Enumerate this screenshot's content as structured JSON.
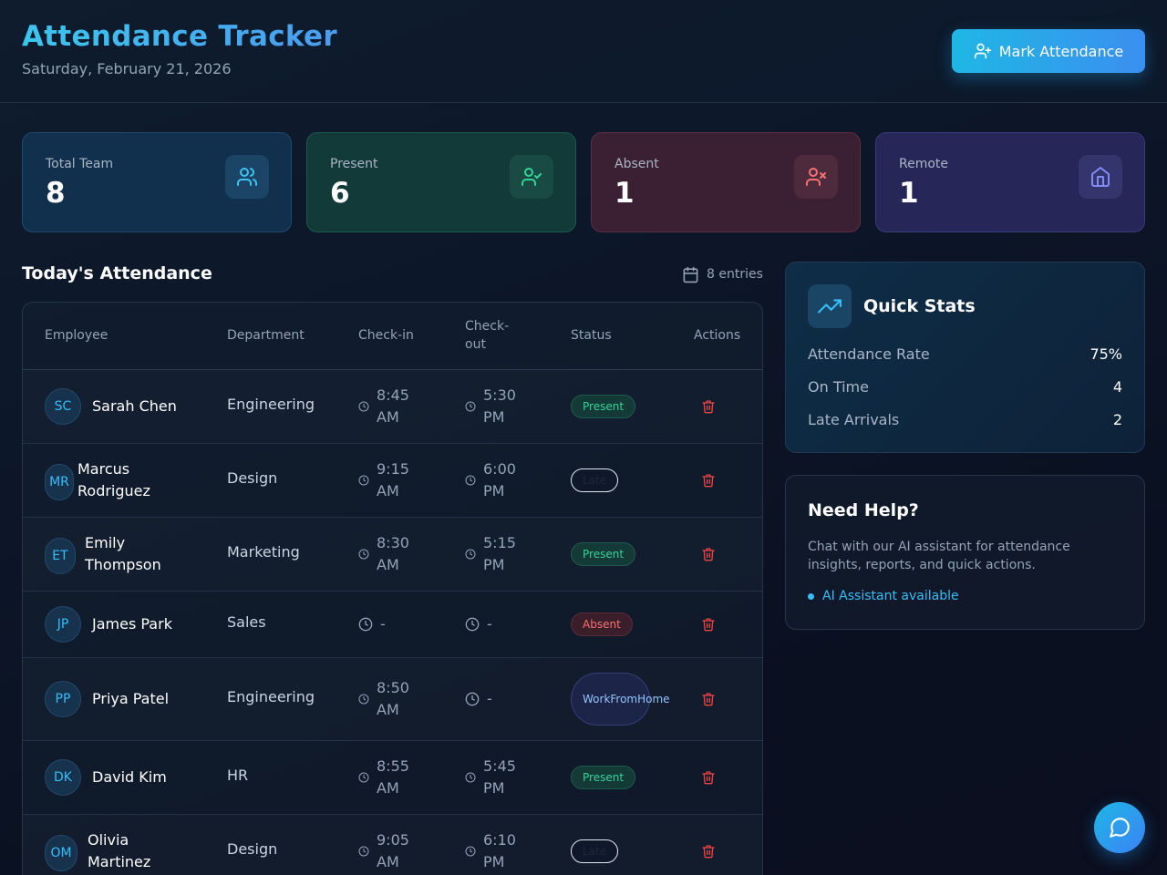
{
  "header": {
    "title": "Attendance Tracker",
    "date": "Saturday, February 21, 2026",
    "mark_button": "Mark Attendance"
  },
  "stats": [
    {
      "label": "Total Team",
      "value": "8",
      "icon": "users-icon"
    },
    {
      "label": "Present",
      "value": "6",
      "icon": "user-check-icon"
    },
    {
      "label": "Absent",
      "value": "1",
      "icon": "user-x-icon"
    },
    {
      "label": "Remote",
      "value": "1",
      "icon": "home-icon"
    }
  ],
  "attendance": {
    "title": "Today's Attendance",
    "entries": "8 entries",
    "columns": {
      "employee": "Employee",
      "department": "Department",
      "checkin": "Check-in",
      "checkout_1": "Check-",
      "checkout_2": "out",
      "status": "Status",
      "actions": "Actions"
    },
    "rows": [
      {
        "initials": "SC",
        "name": "Sarah Chen",
        "department": "Engineering",
        "checkin": [
          "8:45",
          "AM"
        ],
        "checkout": [
          "5:30",
          "PM"
        ],
        "status": "Present"
      },
      {
        "initials": "MR",
        "name": [
          "Marcus",
          "Rodriguez"
        ],
        "department": "Design",
        "checkin": [
          "9:15",
          "AM"
        ],
        "checkout": [
          "6:00",
          "PM"
        ],
        "status": "Late"
      },
      {
        "initials": "ET",
        "name": [
          "Emily",
          "Thompson"
        ],
        "department": "Marketing",
        "checkin": [
          "8:30",
          "AM"
        ],
        "checkout": [
          "5:15",
          "PM"
        ],
        "status": "Present"
      },
      {
        "initials": "JP",
        "name": "James Park",
        "department": "Sales",
        "checkin": "-",
        "checkout": "-",
        "status": "Absent"
      },
      {
        "initials": "PP",
        "name": "Priya Patel",
        "department": "Engineering",
        "checkin": [
          "8:50",
          "AM"
        ],
        "checkout": "-",
        "status": [
          "Work",
          "From",
          "Home"
        ]
      },
      {
        "initials": "DK",
        "name": "David Kim",
        "department": "HR",
        "checkin": [
          "8:55",
          "AM"
        ],
        "checkout": [
          "5:45",
          "PM"
        ],
        "status": "Present"
      },
      {
        "initials": "OM",
        "name": [
          "Olivia",
          "Martinez"
        ],
        "department": "Design",
        "checkin": [
          "9:05",
          "AM"
        ],
        "checkout": [
          "6:10",
          "PM"
        ],
        "status": "Late"
      }
    ]
  },
  "quick_stats": {
    "title": "Quick Stats",
    "items": [
      {
        "label": "Attendance Rate",
        "value": "75%"
      },
      {
        "label": "On Time",
        "value": "4"
      },
      {
        "label": "Late Arrivals",
        "value": "2"
      }
    ]
  },
  "help": {
    "title": "Need Help?",
    "text": "Chat with our AI assistant for attendance insights, reports, and quick actions.",
    "status": "AI Assistant available"
  },
  "colors": {
    "accent": "#1fb7e4",
    "present": "#34d399",
    "absent": "#f87171",
    "remote": "#818cf8",
    "danger": "#ef4444"
  }
}
